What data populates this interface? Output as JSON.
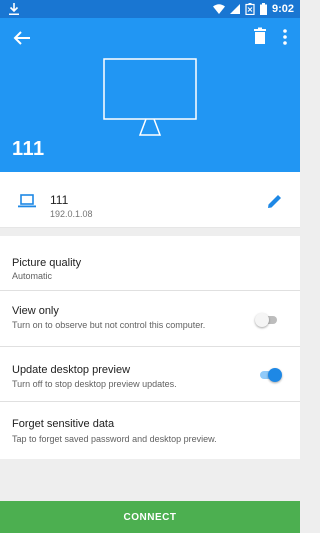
{
  "status_bar": {
    "time": "9:02"
  },
  "header": {
    "title": "111"
  },
  "host": {
    "name": "111",
    "address": "192.0.1.08"
  },
  "settings": {
    "picture_quality": {
      "label": "Picture quality",
      "value": "Automatic"
    },
    "view_only": {
      "label": "View only",
      "description": "Turn on to observe but not control this computer.",
      "enabled": false
    },
    "update_preview": {
      "label": "Update desktop preview",
      "description": "Turn off to stop desktop preview updates.",
      "enabled": true
    },
    "forget": {
      "label": "Forget sensitive data",
      "description": "Tap to forget saved password and desktop preview."
    }
  },
  "actions": {
    "connect_label": "CONNECT"
  },
  "colors": {
    "status_bar": "#1976d2",
    "header": "#2196f3",
    "accent": "#2196f3",
    "connect": "#4caf50"
  }
}
